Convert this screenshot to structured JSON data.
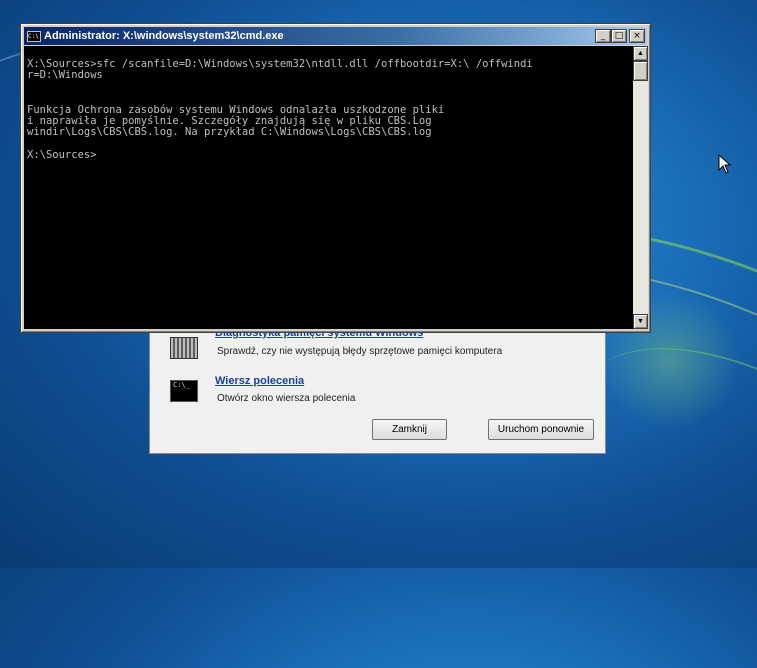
{
  "cmd_window": {
    "title": "Administrator: X:\\windows\\system32\\cmd.exe",
    "icon_label": "C:\\",
    "controls": {
      "minimize": "_",
      "maximize": "□",
      "close": "×"
    },
    "console_lines": [
      "X:\\Sources>sfc /scanfile=D:\\Windows\\system32\\ntdll.dll /offbootdir=X:\\ /offwindi",
      "r=D:\\Windows",
      "",
      "",
      "Funkcja Ochrona zasobów systemu Windows odnalazła uszkodzone pliki",
      "i naprawiła je pomyślnie. Szczegóły znajdują się w pliku CBS.Log",
      "windir\\Logs\\CBS\\CBS.log. Na przykład C:\\Windows\\Logs\\CBS\\CBS.log",
      "",
      "X:\\Sources>"
    ],
    "scroll_up": "▲",
    "scroll_down": "▼"
  },
  "recovery_dialog": {
    "items": [
      {
        "title": "Diagnostyka pamięci systemu Windows",
        "description": "Sprawdź, czy nie występują błędy sprzętowe pamięci komputera"
      },
      {
        "title": "Wiersz polecenia",
        "description": "Otwórz okno wiersza polecenia",
        "icon_label": "C:\\_"
      }
    ],
    "buttons": {
      "close": "Zamknij",
      "restart": "Uruchom ponownie"
    }
  },
  "colors": {
    "console_bg": "#000000",
    "console_text": "#c0c0c0",
    "titlebar_start": "#0a246a",
    "link": "#1a3f9c"
  }
}
